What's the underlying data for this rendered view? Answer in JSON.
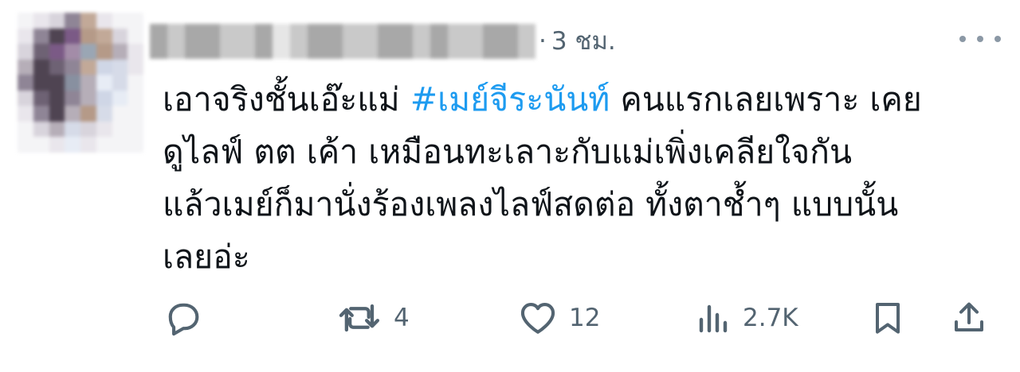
{
  "tweet": {
    "time": "3 ชม.",
    "dot": "·",
    "text_lines": [
      {
        "before": "เอาจริงชั้นเอ๊ะแม่ ",
        "hashtag": "#เมย์จีระนันท์",
        "after": " คนแรกเลยเพราะ เคย"
      },
      {
        "before": "ดูไลฟ์ ตต เค้า เหมือนทะเลาะกับแม่เพิ่งเคลียใจกัน",
        "hashtag": "",
        "after": ""
      },
      {
        "before": "แล้วเมย์ก็มานั่งร้องเพลงไลฟ์สดต่อ ทั้งตาช้ำๆ แบบนั้น",
        "hashtag": "",
        "after": ""
      },
      {
        "before": "เลยอ่ะ",
        "hashtag": "",
        "after": ""
      }
    ],
    "counts": {
      "reply": "",
      "retweet": "4",
      "like": "12",
      "views": "2.7K"
    }
  },
  "colors": {
    "hashtag": "#1d9bf0",
    "meta": "#536471",
    "text": "#0f1419"
  },
  "icons": [
    "more-icon",
    "reply-icon",
    "retweet-icon",
    "like-icon",
    "views-icon",
    "bookmark-icon",
    "share-icon"
  ]
}
